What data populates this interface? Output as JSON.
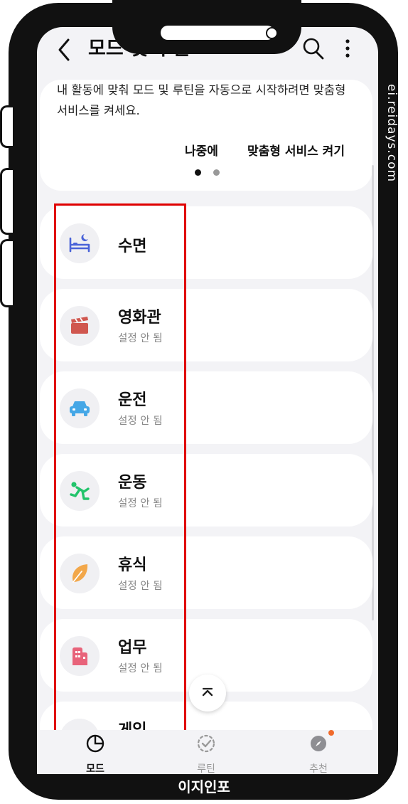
{
  "appbar": {
    "title": "모드 및 루틴",
    "back_icon": "back-arrow-icon",
    "search_icon": "search-icon",
    "more_icon": "more-vert-icon"
  },
  "watermark": "ei.reidays.com",
  "suggestion": {
    "description": "내 활동에 맞춰 모드 및 루틴을 자동으로 시작하려면 맞춤형 서비스를 켜세요.",
    "later_label": "나중에",
    "enable_label": "맞춤형 서비스 켜기",
    "page_dots": [
      "active",
      "inactive"
    ]
  },
  "modes": [
    {
      "name": "수면",
      "status": "",
      "icon": "bed-icon",
      "color": "#4a63d8"
    },
    {
      "name": "영화관",
      "status": "설정 안 됨",
      "icon": "clapperboard-icon",
      "color": "#d0574f"
    },
    {
      "name": "운전",
      "status": "설정 안 됨",
      "icon": "car-icon",
      "color": "#45a7e6"
    },
    {
      "name": "운동",
      "status": "설정 안 됨",
      "icon": "running-icon",
      "color": "#22c46b"
    },
    {
      "name": "휴식",
      "status": "설정 안 됨",
      "icon": "leaf-icon",
      "color": "#f2a74a"
    },
    {
      "name": "업무",
      "status": "설정 안 됨",
      "icon": "building-icon",
      "color": "#e8637a"
    },
    {
      "name": "게임",
      "status": "",
      "icon": "gamepad-icon",
      "color": "#8a7ae0"
    }
  ],
  "scroll_top_icon": "chevron-up-icon",
  "bottom_nav": [
    {
      "label": "모드",
      "icon": "mode-pie-icon",
      "active": true
    },
    {
      "label": "루틴",
      "icon": "routine-check-icon",
      "active": false
    },
    {
      "label": "추천",
      "icon": "compass-icon",
      "active": false,
      "badge_color": "#f06a2b"
    }
  ],
  "caption": "이지인포",
  "colors": {
    "highlight_box": "#e00000",
    "screen_bg": "#f3f3f6",
    "card_bg": "#ffffff"
  }
}
